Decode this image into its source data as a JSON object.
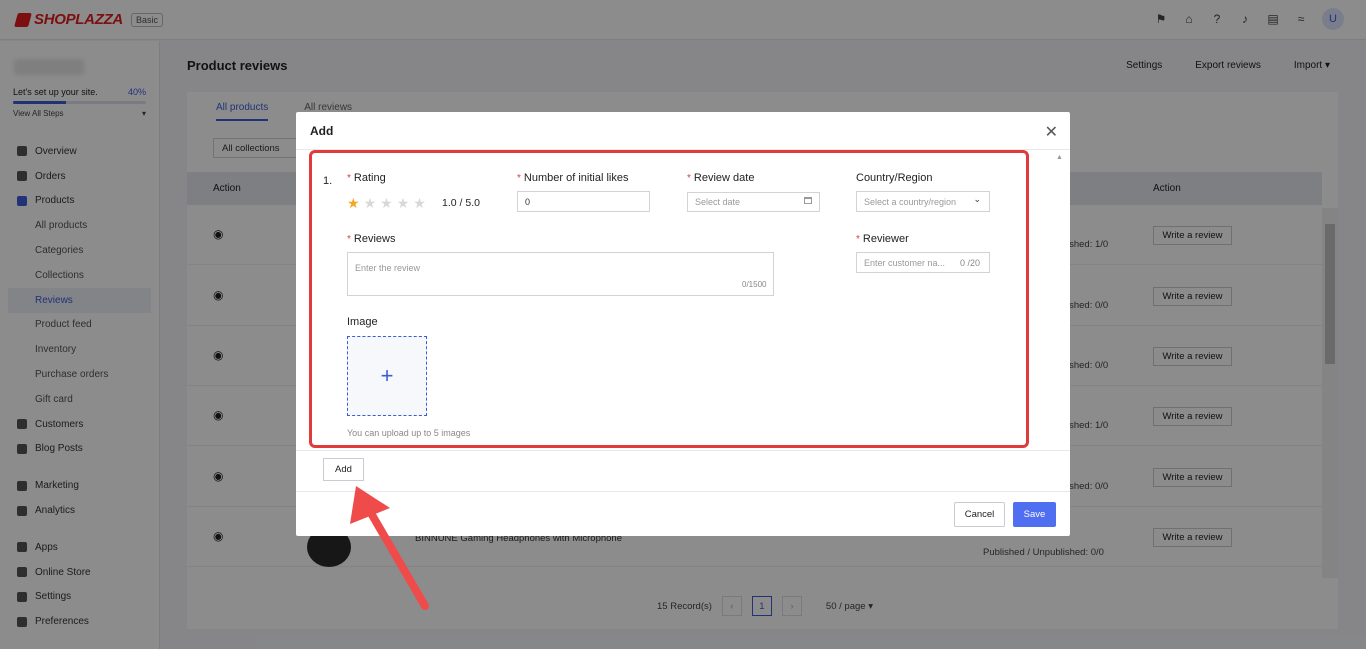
{
  "brand": {
    "name": "SHOPLAZZA",
    "plan": "Basic"
  },
  "topbar": {
    "icons": [
      "flag-icon",
      "store-icon",
      "help-icon",
      "bell-icon",
      "chat-icon",
      "wifi-icon"
    ],
    "avatar": "U"
  },
  "setup": {
    "title": "Let's set up your site.",
    "percent_text": "40%",
    "progress": 0.4,
    "view_all": "View All Steps"
  },
  "sidebar": {
    "items": [
      {
        "label": "Overview",
        "icon": "overview-icon"
      },
      {
        "label": "Orders",
        "icon": "orders-icon"
      },
      {
        "label": "Products",
        "icon": "products-icon"
      },
      {
        "label": "All products"
      },
      {
        "label": "Categories"
      },
      {
        "label": "Collections"
      },
      {
        "label": "Reviews"
      },
      {
        "label": "Product feed"
      },
      {
        "label": "Inventory"
      },
      {
        "label": "Purchase orders"
      },
      {
        "label": "Gift card"
      },
      {
        "label": "Customers",
        "icon": "customers-icon"
      },
      {
        "label": "Blog Posts",
        "icon": "blog-icon"
      },
      {
        "label": "Marketing",
        "icon": "marketing-icon"
      },
      {
        "label": "Analytics",
        "icon": "analytics-icon"
      },
      {
        "label": "Apps",
        "icon": "apps-icon"
      },
      {
        "label": "Online Store",
        "icon": "online-store-icon"
      },
      {
        "label": "Settings",
        "icon": "settings-icon"
      },
      {
        "label": "Preferences",
        "icon": "preferences-icon"
      }
    ]
  },
  "page": {
    "title": "Product reviews",
    "header_links": [
      "Settings",
      "Export reviews",
      "Import"
    ],
    "tabs": [
      "All products",
      "All reviews"
    ],
    "filter": "All collections",
    "table_headers": {
      "action_left": "Action",
      "action_right": "Action"
    },
    "rows": [
      {
        "published": "ished: 1/0",
        "button": "Write a review"
      },
      {
        "published": "ished: 0/0",
        "button": "Write a review"
      },
      {
        "published": "ished: 0/0",
        "button": "Write a review"
      },
      {
        "published": "ished: 1/0",
        "button": "Write a review"
      },
      {
        "published": "ished: 0/0",
        "button": "Write a review"
      },
      {
        "name": "BINNUNE Gaming Headphones with Microphone",
        "published": "Published / Unpublished: 0/0",
        "button": "Write a review"
      }
    ],
    "pager": {
      "records": "15 Record(s)",
      "current": "1",
      "per_page": "50 / page"
    }
  },
  "modal": {
    "title": "Add",
    "index": "1.",
    "rating": {
      "label": "Rating",
      "value_text": "1.0 / 5.0",
      "stars": 1,
      "max": 5
    },
    "likes": {
      "label": "Number of initial likes",
      "value": "0"
    },
    "review_date": {
      "label": "Review date",
      "placeholder": "Select date"
    },
    "country": {
      "label": "Country/Region",
      "placeholder": "Select a country/region"
    },
    "reviews": {
      "label": "Reviews",
      "placeholder": "Enter the review",
      "counter": "0/1500"
    },
    "reviewer": {
      "label": "Reviewer",
      "placeholder": "Enter customer na...",
      "counter": "0 /20"
    },
    "image": {
      "label": "Image",
      "hint": "You can upload up to 5 images"
    },
    "add_button": "Add",
    "cancel_button": "Cancel",
    "save_button": "Save"
  },
  "colors": {
    "accent": "#4f6ef0",
    "highlight": "#e03a3a",
    "star": "#f5a623",
    "brand": "#e21d1d"
  }
}
